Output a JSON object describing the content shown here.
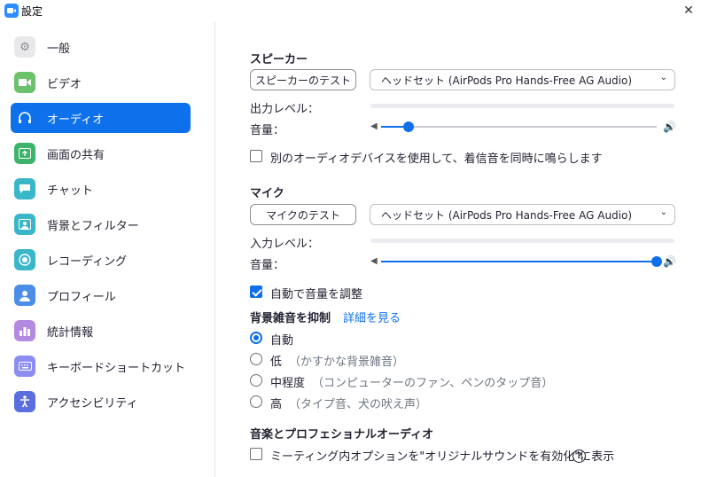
{
  "window": {
    "title": "設定"
  },
  "sidebar": {
    "items": [
      {
        "label": "一般",
        "icon": "gear-icon",
        "color": "#e9e9ec"
      },
      {
        "label": "ビデオ",
        "icon": "video-camera-icon",
        "color": "#6cc26c"
      },
      {
        "label": "オーディオ",
        "icon": "headphones-icon",
        "color": "#0e71eb",
        "active": true
      },
      {
        "label": "画面の共有",
        "icon": "share-screen-icon",
        "color": "#3db36b"
      },
      {
        "label": "チャット",
        "icon": "chat-bubble-icon",
        "color": "#3ab6c9"
      },
      {
        "label": "背景とフィルター",
        "icon": "background-icon",
        "color": "#3ab6c9"
      },
      {
        "label": "レコーディング",
        "icon": "record-icon",
        "color": "#3ab6c9"
      },
      {
        "label": "プロフィール",
        "icon": "profile-icon",
        "color": "#4a8ee8"
      },
      {
        "label": "統計情報",
        "icon": "statistics-icon",
        "color": "#b28ae0"
      },
      {
        "label": "キーボードショートカット",
        "icon": "keyboard-icon",
        "color": "#8a8ef0"
      },
      {
        "label": "アクセシビリティ",
        "icon": "accessibility-icon",
        "color": "#5a6ee0"
      }
    ]
  },
  "speaker": {
    "title": "スピーカー",
    "test_button": "スピーカーのテスト",
    "device": "ヘッドセット (AirPods Pro Hands-Free AG Audio)",
    "output_level_label": "出力レベル：",
    "volume_label": "音量：",
    "volume": 0.1
  },
  "separate_device": {
    "label": "別のオーディオデバイスを使用して、着信音を同時に鳴らします",
    "checked": false
  },
  "mic": {
    "title": "マイク",
    "test_button": "マイクのテスト",
    "device": "ヘッドセット (AirPods Pro Hands-Free AG Audio)",
    "input_level_label": "入力レベル：",
    "volume_label": "音量：",
    "volume": 1.0
  },
  "auto_adjust": {
    "label": "自動で音量を調整",
    "checked": true
  },
  "noise": {
    "title": "背景雑音を抑制",
    "details_link": "詳細を見る",
    "options": [
      {
        "label": "自動",
        "sub": "",
        "checked": true
      },
      {
        "label": "低",
        "sub": "（かすかな背景雑音）",
        "checked": false
      },
      {
        "label": "中程度",
        "sub": "（コンピューターのファン、ペンのタップ音）",
        "checked": false
      },
      {
        "label": "高",
        "sub": "（タイプ音、犬の吠え声）",
        "checked": false
      }
    ]
  },
  "music": {
    "title": "音楽とプロフェショナルオーディオ",
    "original_sound_label": "ミーティング内オプションを\"オリジナルサウンドを有効化\"に表示",
    "checked": false
  },
  "colors": {
    "accent": "#0e71eb"
  }
}
